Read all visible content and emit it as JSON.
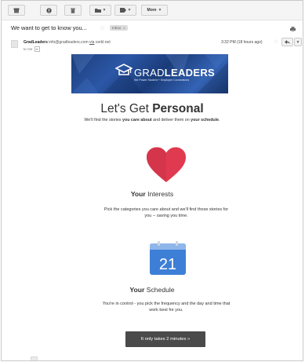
{
  "toolbar": {
    "more_label": "More"
  },
  "message": {
    "subject": "We want to get to know you...",
    "label": "Inbox",
    "label_close": "x",
    "sender_name": "GradLeaders",
    "sender_email": "info@gradleaders.com",
    "via_word": "via",
    "via_domain": "cerkl.net",
    "recipient": "to me",
    "time": "3:32 PM (18 hours ago)"
  },
  "banner": {
    "brand_light": "GRAD",
    "brand_bold": "LEADERS",
    "tagline": "We Power Student + Employer Connections"
  },
  "email": {
    "headline_prefix": "Let's Get ",
    "headline_bold": "Personal",
    "sub_a": "We'll find the stories ",
    "sub_b": "you care about",
    "sub_c": " and deliver them on ",
    "sub_d": "your schedule",
    "sub_e": ".",
    "interests_bold": "Your",
    "interests_rest": " Interests",
    "interests_line1": "Pick the categories you care about and we'll find those stories for",
    "interests_line2": "you -- saving you time.",
    "calendar_day": "21",
    "schedule_bold": "Your",
    "schedule_rest": " Schedule",
    "schedule_line1": "You're in control - you pick the frequency and the day and time that",
    "schedule_line2": "work best for you.",
    "cta": "It only takes 2 minutes »"
  },
  "colors": {
    "heart": "#e03a50",
    "calendar": "#3d7fd6",
    "cta_bg": "#4a4a4a"
  }
}
